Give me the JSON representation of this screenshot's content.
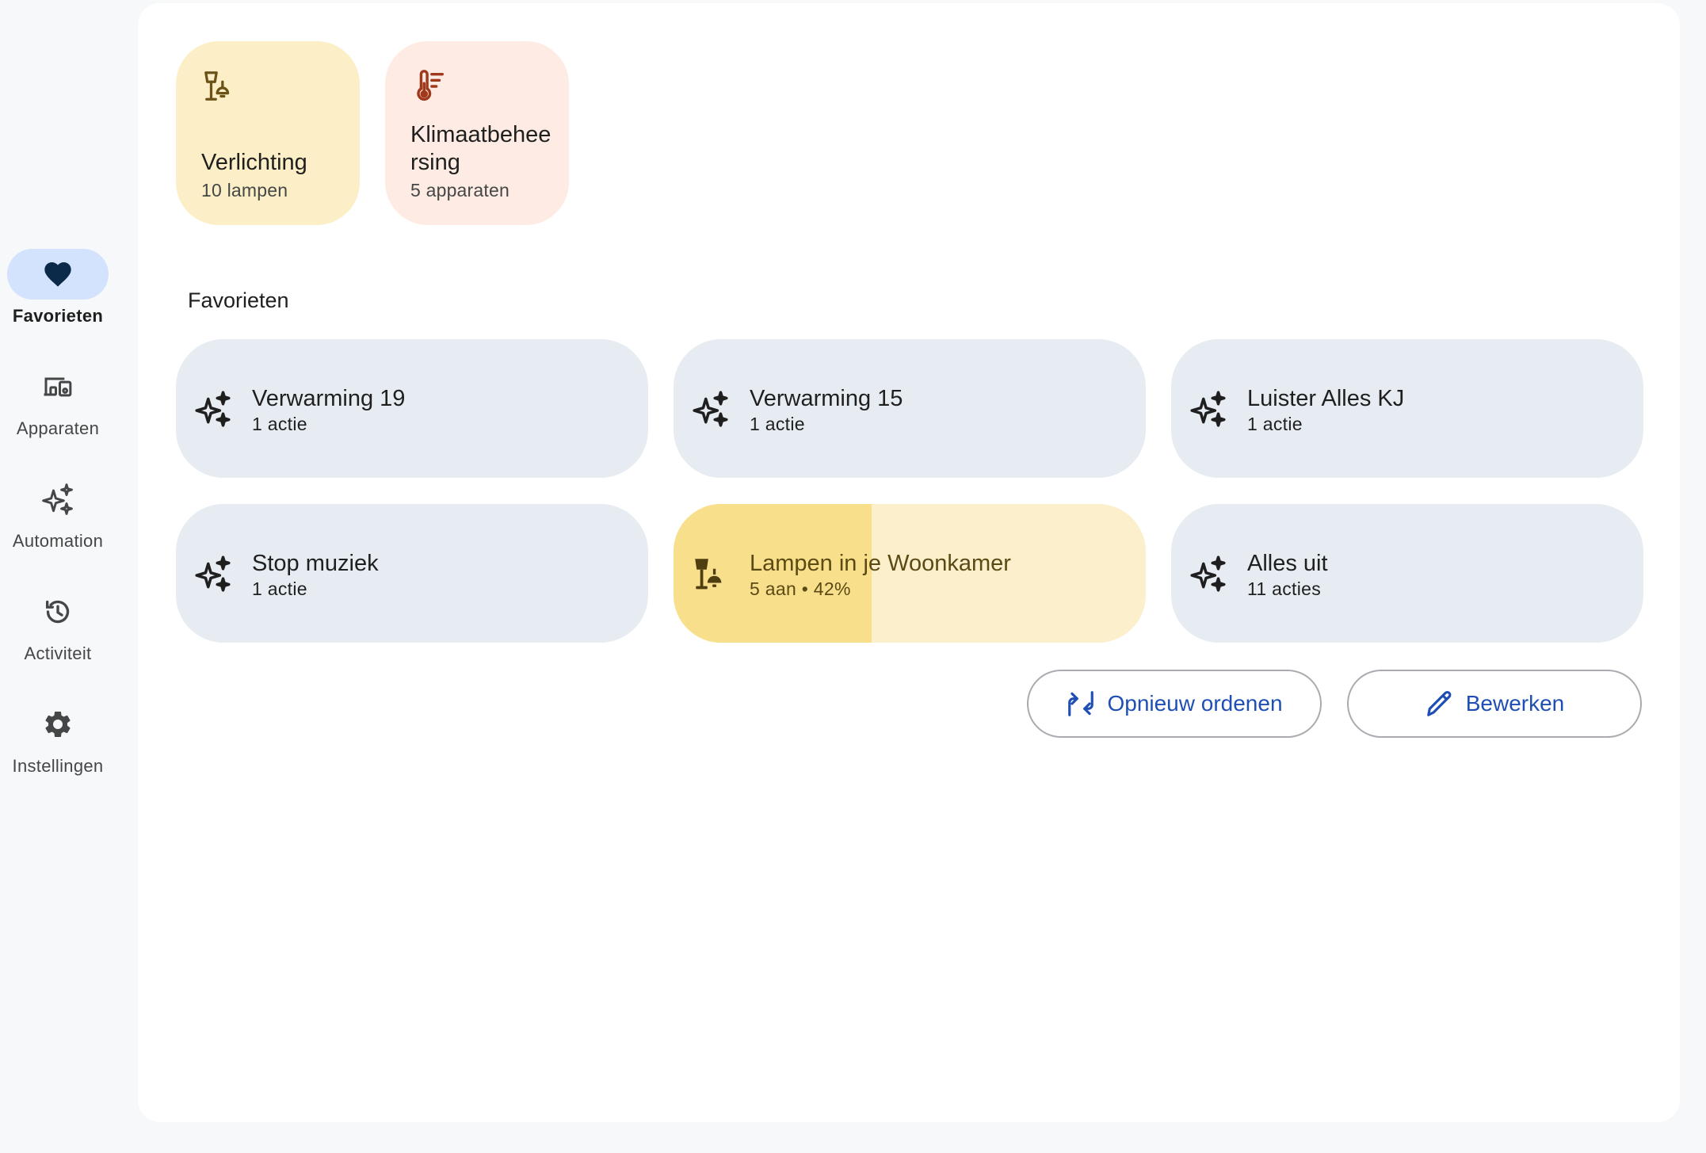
{
  "sidebar": {
    "items": [
      {
        "label": "Favorieten",
        "icon": "heart-icon",
        "active": true
      },
      {
        "label": "Apparaten",
        "icon": "devices-icon",
        "active": false
      },
      {
        "label": "Automation",
        "icon": "sparkle-icon",
        "active": false
      },
      {
        "label": "Activiteit",
        "icon": "history-icon",
        "active": false
      },
      {
        "label": "Instellingen",
        "icon": "gear-icon",
        "active": false
      }
    ]
  },
  "tiles": [
    {
      "title": "Verlichting",
      "subtitle": "10 lampen",
      "icon": "lamp-icon",
      "color": "#fcefc7"
    },
    {
      "title": "Klimaatbeheersing",
      "subtitle": "5 apparaten",
      "icon": "thermostat-icon",
      "color": "#fdebe4"
    }
  ],
  "favorites": {
    "title": "Favorieten",
    "items": [
      {
        "title": "Verwarming 19",
        "subtitle": "1 actie",
        "icon": "sparkle-icon"
      },
      {
        "title": "Verwarming 15",
        "subtitle": "1 actie",
        "icon": "sparkle-icon"
      },
      {
        "title": "Luister Alles KJ",
        "subtitle": "1 actie",
        "icon": "sparkle-icon"
      },
      {
        "title": "Stop muziek",
        "subtitle": "1 actie",
        "icon": "sparkle-icon"
      },
      {
        "title": "Lampen in je Woonkamer",
        "subtitle": "5 aan • 42%",
        "icon": "lamp-icon",
        "brightness": 0.42
      },
      {
        "title": "Alles uit",
        "subtitle": "11 acties",
        "icon": "sparkle-icon"
      }
    ]
  },
  "actions": {
    "reorder_label": "Opnieuw ordenen",
    "edit_label": "Bewerken"
  },
  "colors": {
    "accent": "#1f4fb4",
    "nav_active": "#d3e3fd",
    "fav_background": "#e7ecf2",
    "light_fill": "#f8df8b"
  }
}
